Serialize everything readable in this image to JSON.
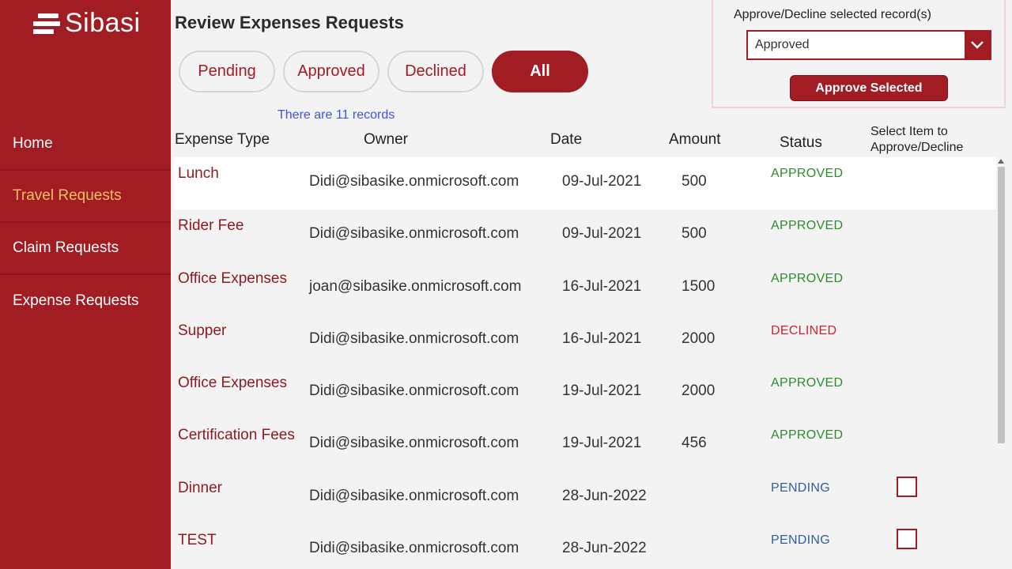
{
  "brand": {
    "name": "Sibasi"
  },
  "nav": [
    {
      "label": "Home",
      "active": false
    },
    {
      "label": "Travel Requests",
      "active": true
    },
    {
      "label": "Claim Requests",
      "active": false
    },
    {
      "label": "Expense Requests",
      "active": false
    }
  ],
  "header": {
    "title": "Review Expenses Requests"
  },
  "tabs": [
    {
      "label": "Pending"
    },
    {
      "label": "Approved"
    },
    {
      "label": "Declined"
    },
    {
      "label": "All",
      "selected": true
    }
  ],
  "record_count": "There are 11 records",
  "action_panel": {
    "label": "Approve/Decline selected record(s)",
    "select_value": "Approved",
    "button_label": "Approve Selected"
  },
  "table": {
    "headers": [
      "Expense Type",
      "Owner",
      "Date",
      "Amount",
      "Status",
      "Select Item to",
      "Approve/Decline"
    ],
    "rows": [
      {
        "type": "Lunch",
        "owner": "Didi@sibasike.onmicrosoft.com",
        "date": "09-Jul-2021",
        "amount": "500",
        "status": "APPROVED",
        "checkbox": false
      },
      {
        "type": "Rider Fee",
        "owner": "Didi@sibasike.onmicrosoft.com",
        "date": "09-Jul-2021",
        "amount": "500",
        "status": "APPROVED",
        "checkbox": false
      },
      {
        "type": "Office Expenses",
        "owner": "joan@sibasike.onmicrosoft.com",
        "date": "16-Jul-2021",
        "amount": "1500",
        "status": "APPROVED",
        "checkbox": false
      },
      {
        "type": "Supper",
        "owner": "Didi@sibasike.onmicrosoft.com",
        "date": "16-Jul-2021",
        "amount": "2000",
        "status": "DECLINED",
        "checkbox": false
      },
      {
        "type": "Office Expenses",
        "owner": "Didi@sibasike.onmicrosoft.com",
        "date": "19-Jul-2021",
        "amount": "2000",
        "status": "APPROVED",
        "checkbox": false
      },
      {
        "type": "Certification Fees",
        "owner": "Didi@sibasike.onmicrosoft.com",
        "date": "19-Jul-2021",
        "amount": "456",
        "status": "APPROVED",
        "checkbox": false
      },
      {
        "type": "Dinner",
        "owner": "Didi@sibasike.onmicrosoft.com",
        "date": "28-Jun-2022",
        "amount": "",
        "status": "PENDING",
        "checkbox": true
      },
      {
        "type": "TEST",
        "owner": "Didi@sibasike.onmicrosoft.com",
        "date": "28-Jun-2022",
        "amount": "",
        "status": "PENDING",
        "checkbox": true
      }
    ]
  },
  "colors": {
    "brand": "#a21c24",
    "approved": "#2e8b2e",
    "declined": "#d21f2a",
    "pending": "#2f5f9e",
    "active_nav": "#f2c062",
    "link": "#3f51e8"
  },
  "icons": {
    "select_chevron": "chevron-down-icon",
    "logo": "sibasi-logo-icon"
  }
}
